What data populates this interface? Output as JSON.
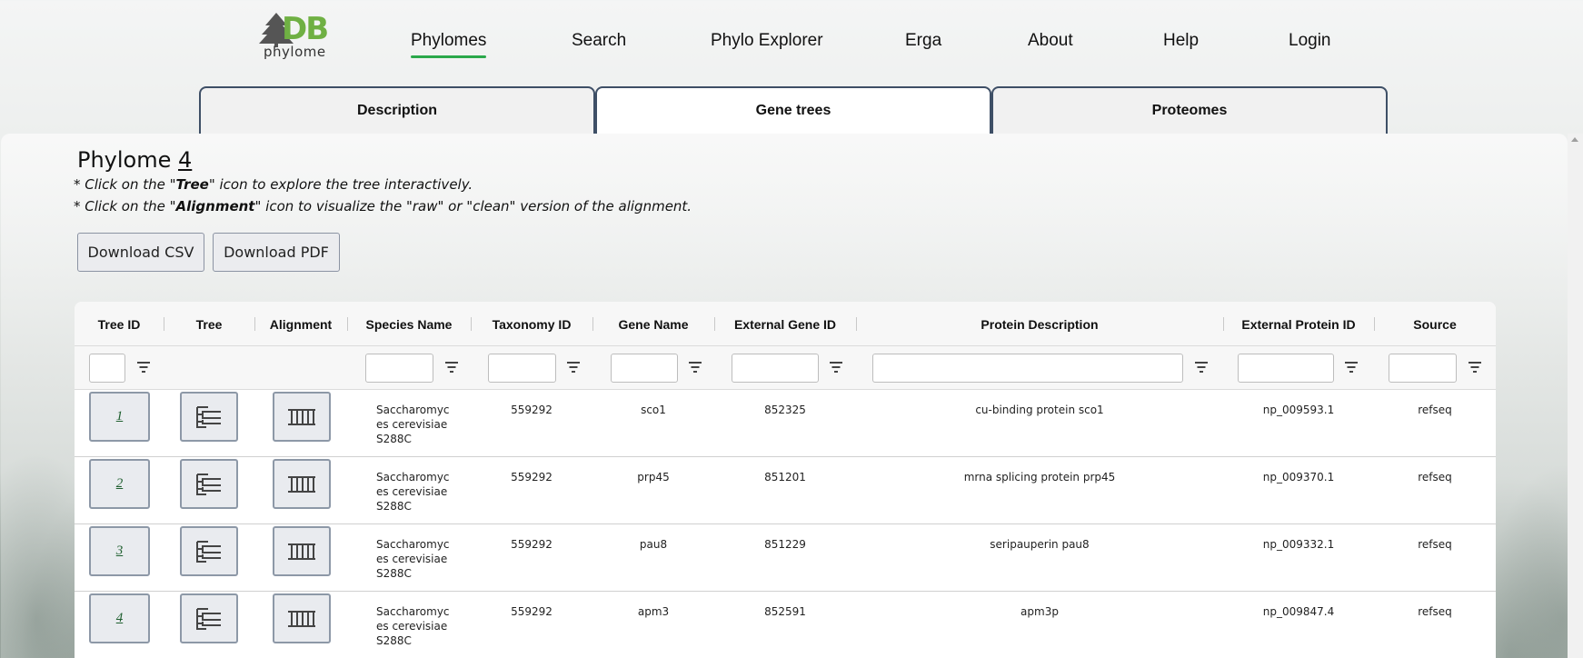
{
  "brand": {
    "logo_letters": "DB",
    "logo_text": "phylome",
    "accent": "#2aa84a"
  },
  "nav": [
    {
      "label": "Phylomes",
      "active": true
    },
    {
      "label": "Search",
      "active": false
    },
    {
      "label": "Phylo Explorer",
      "active": false
    },
    {
      "label": "Erga",
      "active": false
    },
    {
      "label": "About",
      "active": false
    },
    {
      "label": "Help",
      "active": false
    },
    {
      "label": "Login",
      "active": false
    }
  ],
  "tabs": [
    {
      "label": "Description",
      "active": false
    },
    {
      "label": "Gene trees",
      "active": true
    },
    {
      "label": "Proteomes",
      "active": false
    }
  ],
  "page": {
    "title_prefix": "Phylome ",
    "title_number": "4",
    "note1_a": "* Click on the \"",
    "note1_b": "Tree",
    "note1_c": "\" icon to explore the tree interactively.",
    "note2_a": "* Click on the \"",
    "note2_b": "Alignment",
    "note2_c": "\" icon to visualize the \"raw\" or \"clean\" version of the alignment.",
    "download_csv": "Download CSV",
    "download_pdf": "Download PDF"
  },
  "table": {
    "columns": [
      "Tree ID",
      "Tree",
      "Alignment",
      "Species Name",
      "Taxonomy ID",
      "Gene Name",
      "External Gene ID",
      "Protein Description",
      "External Protein ID",
      "Source"
    ],
    "rows": [
      {
        "tree_id": "1",
        "species": "Saccharomyces cerevisiae S288C",
        "taxonomy_id": "559292",
        "gene_name": "sco1",
        "external_gene_id": "852325",
        "protein_description": "cu-binding protein sco1",
        "external_protein_id": "np_009593.1",
        "source": "refseq"
      },
      {
        "tree_id": "2",
        "species": "Saccharomyces cerevisiae S288C",
        "taxonomy_id": "559292",
        "gene_name": "prp45",
        "external_gene_id": "851201",
        "protein_description": "mrna splicing protein prp45",
        "external_protein_id": "np_009370.1",
        "source": "refseq"
      },
      {
        "tree_id": "3",
        "species": "Saccharomyces cerevisiae S288C",
        "taxonomy_id": "559292",
        "gene_name": "pau8",
        "external_gene_id": "851229",
        "protein_description": "seripauperin pau8",
        "external_protein_id": "np_009332.1",
        "source": "refseq"
      },
      {
        "tree_id": "4",
        "species": "Saccharomyces cerevisiae S288C",
        "taxonomy_id": "559292",
        "gene_name": "apm3",
        "external_gene_id": "852591",
        "protein_description": "apm3p",
        "external_protein_id": "np_009847.4",
        "source": "refseq"
      }
    ]
  }
}
